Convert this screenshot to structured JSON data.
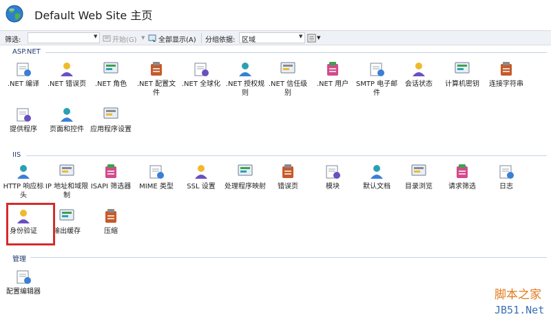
{
  "header": {
    "title": "Default Web Site 主页"
  },
  "toolbar": {
    "filter_label": "筛选:",
    "filter_value": "",
    "start_label": "开始(G)",
    "show_all_label": "全部显示(A)",
    "group_label": "分组依据:",
    "group_value": "区域"
  },
  "sections": {
    "aspnet": {
      "label": "ASP.NET",
      "items": [
        {
          "label": ".NET 编译",
          "icon": "net-compilation-icon"
        },
        {
          "label": ".NET 错误页",
          "icon": "net-error-pages-icon"
        },
        {
          "label": ".NET 角色",
          "icon": "net-roles-icon"
        },
        {
          "label": ".NET 配置文件",
          "icon": "net-profile-icon"
        },
        {
          "label": ".NET 全球化",
          "icon": "net-globalization-icon"
        },
        {
          "label": ".NET 授权规则",
          "icon": "net-authorization-icon"
        },
        {
          "label": ".NET 信任级别",
          "icon": "net-trust-levels-icon"
        },
        {
          "label": ".NET 用户",
          "icon": "net-users-icon"
        },
        {
          "label": "SMTP 电子邮件",
          "icon": "smtp-email-icon"
        },
        {
          "label": "会话状态",
          "icon": "session-state-icon"
        },
        {
          "label": "计算机密钥",
          "icon": "machine-key-icon"
        },
        {
          "label": "连接字符串",
          "icon": "connection-strings-icon"
        },
        {
          "label": "提供程序",
          "icon": "providers-icon"
        },
        {
          "label": "页面和控件",
          "icon": "pages-controls-icon"
        },
        {
          "label": "应用程序设置",
          "icon": "app-settings-icon"
        }
      ]
    },
    "iis": {
      "label": "IIS",
      "items": [
        {
          "label": "HTTP 响应标头",
          "icon": "http-headers-icon"
        },
        {
          "label": "IP 地址和域限制",
          "icon": "ip-restrictions-icon"
        },
        {
          "label": "ISAPI 筛选器",
          "icon": "isapi-filters-icon"
        },
        {
          "label": "MIME 类型",
          "icon": "mime-types-icon"
        },
        {
          "label": "SSL 设置",
          "icon": "ssl-settings-icon"
        },
        {
          "label": "处理程序映射",
          "icon": "handler-mappings-icon"
        },
        {
          "label": "错误页",
          "icon": "error-pages-icon"
        },
        {
          "label": "模块",
          "icon": "modules-icon"
        },
        {
          "label": "默认文档",
          "icon": "default-document-icon"
        },
        {
          "label": "目录浏览",
          "icon": "directory-browsing-icon"
        },
        {
          "label": "请求筛选",
          "icon": "request-filtering-icon"
        },
        {
          "label": "日志",
          "icon": "logging-icon"
        },
        {
          "label": "身份验证",
          "icon": "authentication-icon"
        },
        {
          "label": "输出缓存",
          "icon": "output-caching-icon"
        },
        {
          "label": "压缩",
          "icon": "compression-icon"
        }
      ]
    },
    "management": {
      "label": "管理",
      "items": [
        {
          "label": "配置编辑器",
          "icon": "configuration-editor-icon"
        }
      ]
    }
  },
  "watermark": {
    "line1": "脚本之家",
    "line2": "JB51.Net"
  },
  "colors": {
    "highlight": "#d42b2b",
    "section_line": "#c4d2e5",
    "toolbar_bg": "#eef1f5"
  }
}
